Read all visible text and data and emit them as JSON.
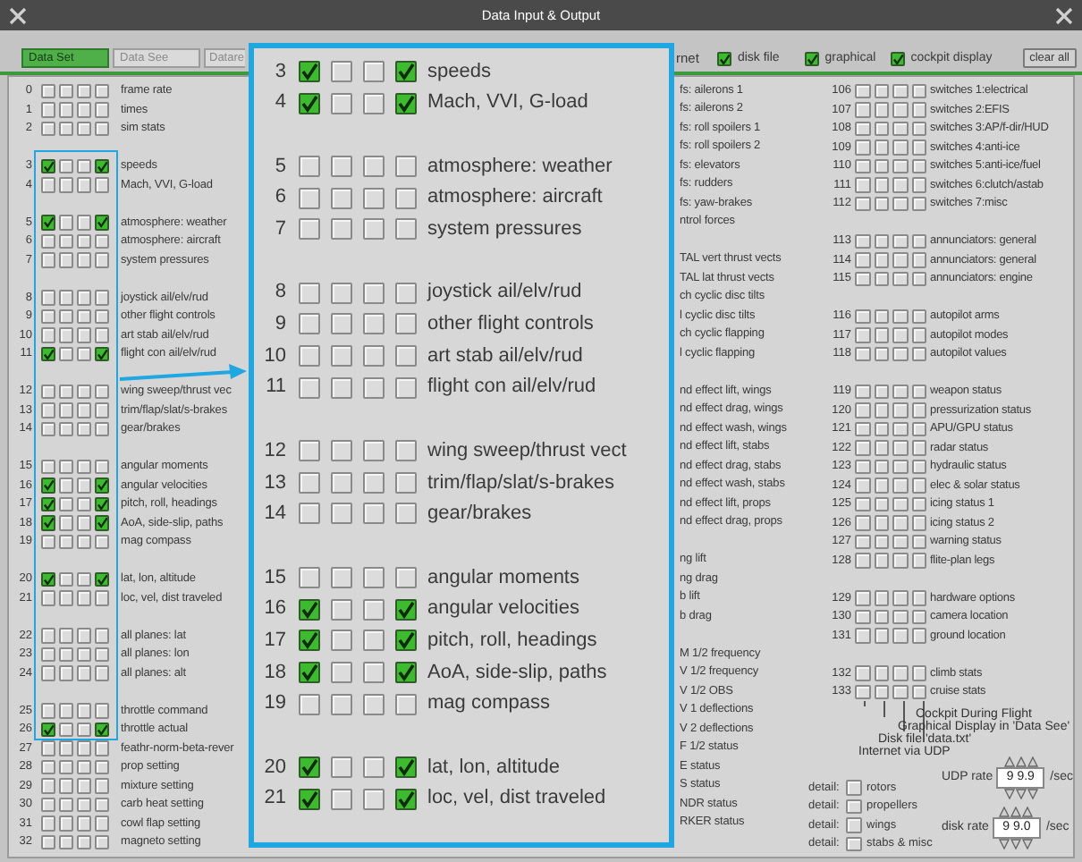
{
  "window": {
    "title": "Data Input & Output"
  },
  "tabs": [
    {
      "label": "Data Set",
      "selected": true
    },
    {
      "label": "Data See",
      "selected": false
    },
    {
      "label": "Datare",
      "selected": false
    }
  ],
  "output_cut_label": "rnet",
  "outputs": [
    {
      "label": "disk file",
      "checked": true
    },
    {
      "label": "graphical",
      "checked": true
    },
    {
      "label": "cockpit display",
      "checked": true
    }
  ],
  "clear_button": "clear all",
  "left_column": {
    "groups": [
      [
        {
          "number": "0",
          "checks": [
            false,
            false,
            false,
            false
          ],
          "label": "frame rate"
        },
        {
          "number": "1",
          "checks": [
            false,
            false,
            false,
            false
          ],
          "label": "times"
        },
        {
          "number": "2",
          "checks": [
            false,
            false,
            false,
            false
          ],
          "label": "sim stats"
        }
      ],
      [
        {
          "number": "3",
          "checks": [
            true,
            false,
            false,
            true
          ],
          "label": "speeds"
        },
        {
          "number": "4",
          "checks": [
            false,
            false,
            false,
            false
          ],
          "label": "Mach, VVI, G-load"
        }
      ],
      [
        {
          "number": "5",
          "checks": [
            true,
            false,
            false,
            true
          ],
          "label": "atmosphere: weather"
        },
        {
          "number": "6",
          "checks": [
            false,
            false,
            false,
            false
          ],
          "label": "atmosphere: aircraft"
        },
        {
          "number": "7",
          "checks": [
            false,
            false,
            false,
            false
          ],
          "label": "system pressures"
        }
      ],
      [
        {
          "number": "8",
          "checks": [
            false,
            false,
            false,
            false
          ],
          "label": "joystick ail/elv/rud"
        },
        {
          "number": "9",
          "checks": [
            false,
            false,
            false,
            false
          ],
          "label": "other flight controls"
        },
        {
          "number": "10",
          "checks": [
            false,
            false,
            false,
            false
          ],
          "label": "art stab ail/elv/rud"
        },
        {
          "number": "11",
          "checks": [
            true,
            false,
            false,
            true
          ],
          "label": "flight con ail/elv/rud"
        }
      ],
      [
        {
          "number": "12",
          "checks": [
            false,
            false,
            false,
            false
          ],
          "label": "wing sweep/thrust vec"
        },
        {
          "number": "13",
          "checks": [
            false,
            false,
            false,
            false
          ],
          "label": "trim/flap/slat/s-brakes"
        },
        {
          "number": "14",
          "checks": [
            false,
            false,
            false,
            false
          ],
          "label": "gear/brakes"
        }
      ],
      [
        {
          "number": "15",
          "checks": [
            false,
            false,
            false,
            false
          ],
          "label": "angular moments"
        },
        {
          "number": "16",
          "checks": [
            true,
            false,
            false,
            true
          ],
          "label": "angular velocities"
        },
        {
          "number": "17",
          "checks": [
            true,
            false,
            false,
            true
          ],
          "label": "pitch, roll, headings"
        },
        {
          "number": "18",
          "checks": [
            true,
            false,
            false,
            true
          ],
          "label": "AoA, side-slip, paths"
        },
        {
          "number": "19",
          "checks": [
            false,
            false,
            false,
            false
          ],
          "label": "mag compass"
        }
      ],
      [
        {
          "number": "20",
          "checks": [
            true,
            false,
            false,
            true
          ],
          "label": "lat, lon, altitude"
        },
        {
          "number": "21",
          "checks": [
            false,
            false,
            false,
            false
          ],
          "label": "loc, vel, dist traveled"
        }
      ],
      [
        {
          "number": "22",
          "checks": [
            false,
            false,
            false,
            false
          ],
          "label": "all planes: lat"
        },
        {
          "number": "23",
          "checks": [
            false,
            false,
            false,
            false
          ],
          "label": "all planes: lon"
        },
        {
          "number": "24",
          "checks": [
            false,
            false,
            false,
            false
          ],
          "label": "all planes: alt"
        }
      ],
      [
        {
          "number": "25",
          "checks": [
            false,
            false,
            false,
            false
          ],
          "label": "throttle command"
        },
        {
          "number": "26",
          "checks": [
            true,
            false,
            false,
            true
          ],
          "label": "throttle actual"
        },
        {
          "number": "27",
          "checks": [
            false,
            false,
            false,
            false
          ],
          "label": "feathr-norm-beta-rever"
        },
        {
          "number": "28",
          "checks": [
            false,
            false,
            false,
            false
          ],
          "label": "prop setting"
        },
        {
          "number": "29",
          "checks": [
            false,
            false,
            false,
            false
          ],
          "label": "mixture setting"
        },
        {
          "number": "30",
          "checks": [
            false,
            false,
            false,
            false
          ],
          "label": "carb heat setting"
        },
        {
          "number": "31",
          "checks": [
            false,
            false,
            false,
            false
          ],
          "label": "cowl flap setting"
        },
        {
          "number": "32",
          "checks": [
            false,
            false,
            false,
            false
          ],
          "label": "magneto setting"
        }
      ]
    ]
  },
  "middle_column": {
    "groups": [
      [
        "fs: ailerons 1",
        "fs: ailerons 2",
        "fs: roll spoilers 1",
        "fs: roll spoilers 2",
        "fs: elevators",
        "fs: rudders",
        "fs: yaw-brakes",
        "ntrol forces"
      ],
      [
        "TAL vert thrust vects",
        "TAL lat thrust vects",
        "ch cyclic disc tilts",
        "l cyclic disc tilts",
        "ch cyclic flapping",
        "l cyclic flapping"
      ],
      [
        "nd effect lift, wings",
        "nd effect drag, wings",
        "nd effect wash, wings",
        "nd effect lift, stabs",
        "nd effect drag, stabs",
        "nd effect wash, stabs",
        "nd effect lift, props",
        "nd effect drag, props"
      ],
      [
        "ng lift",
        "ng drag",
        "b lift",
        "b drag"
      ],
      [
        "M 1/2 frequency",
        "V 1/2 frequency",
        "V 1/2 OBS",
        "V 1 deflections",
        "V 2 deflections",
        "F 1/2 status",
        "E status",
        "S status",
        "NDR status",
        "RKER status"
      ]
    ]
  },
  "right_column": {
    "groups": [
      [
        {
          "number": "106",
          "checks": [
            false,
            false,
            false,
            false
          ],
          "label": "switches 1:electrical"
        },
        {
          "number": "107",
          "checks": [
            false,
            false,
            false,
            false
          ],
          "label": "switches 2:EFIS"
        },
        {
          "number": "108",
          "checks": [
            false,
            false,
            false,
            false
          ],
          "label": "switches 3:AP/f-dir/HUD"
        },
        {
          "number": "109",
          "checks": [
            false,
            false,
            false,
            false
          ],
          "label": "switches 4:anti-ice"
        },
        {
          "number": "110",
          "checks": [
            false,
            false,
            false,
            false
          ],
          "label": "switches 5:anti-ice/fuel"
        },
        {
          "number": "111",
          "checks": [
            false,
            false,
            false,
            false
          ],
          "label": "switches 6:clutch/astab"
        },
        {
          "number": "112",
          "checks": [
            false,
            false,
            false,
            false
          ],
          "label": "switches 7:misc"
        }
      ],
      [
        {
          "number": "113",
          "checks": [
            false,
            false,
            false,
            false
          ],
          "label": "annunciators: general"
        },
        {
          "number": "114",
          "checks": [
            false,
            false,
            false,
            false
          ],
          "label": "annunciators: general"
        },
        {
          "number": "115",
          "checks": [
            false,
            false,
            false,
            false
          ],
          "label": "annunciators: engine"
        }
      ],
      [
        {
          "number": "116",
          "checks": [
            false,
            false,
            false,
            false
          ],
          "label": "autopilot arms"
        },
        {
          "number": "117",
          "checks": [
            false,
            false,
            false,
            false
          ],
          "label": "autopilot modes"
        },
        {
          "number": "118",
          "checks": [
            false,
            false,
            false,
            false
          ],
          "label": "autopilot values"
        }
      ],
      [
        {
          "number": "119",
          "checks": [
            false,
            false,
            false,
            false
          ],
          "label": "weapon status"
        },
        {
          "number": "120",
          "checks": [
            false,
            false,
            false,
            false
          ],
          "label": "pressurization status"
        },
        {
          "number": "121",
          "checks": [
            false,
            false,
            false,
            false
          ],
          "label": "APU/GPU status"
        },
        {
          "number": "122",
          "checks": [
            false,
            false,
            false,
            false
          ],
          "label": "radar status"
        },
        {
          "number": "123",
          "checks": [
            false,
            false,
            false,
            false
          ],
          "label": "hydraulic status"
        },
        {
          "number": "124",
          "checks": [
            false,
            false,
            false,
            false
          ],
          "label": "elec & solar status"
        },
        {
          "number": "125",
          "checks": [
            false,
            false,
            false,
            false
          ],
          "label": "icing status 1"
        },
        {
          "number": "126",
          "checks": [
            false,
            false,
            false,
            false
          ],
          "label": "icing status 2"
        },
        {
          "number": "127",
          "checks": [
            false,
            false,
            false,
            false
          ],
          "label": "warning status"
        },
        {
          "number": "128",
          "checks": [
            false,
            false,
            false,
            false
          ],
          "label": "flite-plan legs"
        }
      ],
      [
        {
          "number": "129",
          "checks": [
            false,
            false,
            false,
            false
          ],
          "label": "hardware options"
        },
        {
          "number": "130",
          "checks": [
            false,
            false,
            false,
            false
          ],
          "label": "camera location"
        },
        {
          "number": "131",
          "checks": [
            false,
            false,
            false,
            false
          ],
          "label": "ground location"
        }
      ],
      [
        {
          "number": "132",
          "checks": [
            false,
            false,
            false,
            false
          ],
          "label": "climb stats"
        },
        {
          "number": "133",
          "checks": [
            false,
            false,
            false,
            false
          ],
          "label": "cruise stats"
        }
      ]
    ]
  },
  "legend": [
    "Cockpit During Flight",
    "Graphical Display in 'Data See'",
    "Disk file 'data.txt'",
    "Internet via UDP"
  ],
  "details": [
    {
      "prefix": "detail:",
      "checked": false,
      "label": "rotors"
    },
    {
      "prefix": "detail:",
      "checked": false,
      "label": "propellers"
    },
    {
      "prefix": "detail:",
      "checked": false,
      "label": "wings"
    },
    {
      "prefix": "detail:",
      "checked": false,
      "label": "stabs & misc"
    }
  ],
  "rates": [
    {
      "label": "UDP rate",
      "value": "9 9.9",
      "unit": "/sec"
    },
    {
      "label": "disk rate",
      "value": "9 9.0",
      "unit": "/sec"
    }
  ],
  "callout": {
    "groups": [
      [
        {
          "number": "3",
          "checks": [
            true,
            false,
            false,
            true
          ],
          "label": "speeds"
        },
        {
          "number": "4",
          "checks": [
            true,
            false,
            false,
            true
          ],
          "label": "Mach, VVI, G-load"
        }
      ],
      [
        {
          "number": "5",
          "checks": [
            false,
            false,
            false,
            false
          ],
          "label": "atmosphere: weather"
        },
        {
          "number": "6",
          "checks": [
            false,
            false,
            false,
            false
          ],
          "label": "atmosphere: aircraft"
        },
        {
          "number": "7",
          "checks": [
            false,
            false,
            false,
            false
          ],
          "label": "system pressures"
        }
      ],
      [
        {
          "number": "8",
          "checks": [
            false,
            false,
            false,
            false
          ],
          "label": "joystick ail/elv/rud"
        },
        {
          "number": "9",
          "checks": [
            false,
            false,
            false,
            false
          ],
          "label": "other flight controls"
        },
        {
          "number": "10",
          "checks": [
            false,
            false,
            false,
            false
          ],
          "label": "art stab ail/elv/rud"
        },
        {
          "number": "11",
          "checks": [
            false,
            false,
            false,
            false
          ],
          "label": "flight con ail/elv/rud"
        }
      ],
      [
        {
          "number": "12",
          "checks": [
            false,
            false,
            false,
            false
          ],
          "label": "wing sweep/thrust vect"
        },
        {
          "number": "13",
          "checks": [
            false,
            false,
            false,
            false
          ],
          "label": "trim/flap/slat/s-brakes"
        },
        {
          "number": "14",
          "checks": [
            false,
            false,
            false,
            false
          ],
          "label": "gear/brakes"
        }
      ],
      [
        {
          "number": "15",
          "checks": [
            false,
            false,
            false,
            false
          ],
          "label": "angular moments"
        },
        {
          "number": "16",
          "checks": [
            true,
            false,
            false,
            true
          ],
          "label": "angular velocities"
        },
        {
          "number": "17",
          "checks": [
            true,
            false,
            false,
            true
          ],
          "label": "pitch, roll, headings"
        },
        {
          "number": "18",
          "checks": [
            true,
            false,
            false,
            true
          ],
          "label": "AoA, side-slip, paths"
        },
        {
          "number": "19",
          "checks": [
            false,
            false,
            false,
            false
          ],
          "label": "mag compass"
        }
      ],
      [
        {
          "number": "20",
          "checks": [
            true,
            false,
            false,
            true
          ],
          "label": "lat, lon, altitude"
        },
        {
          "number": "21",
          "checks": [
            true,
            false,
            false,
            true
          ],
          "label": "loc, vel, dist traveled"
        }
      ]
    ]
  }
}
